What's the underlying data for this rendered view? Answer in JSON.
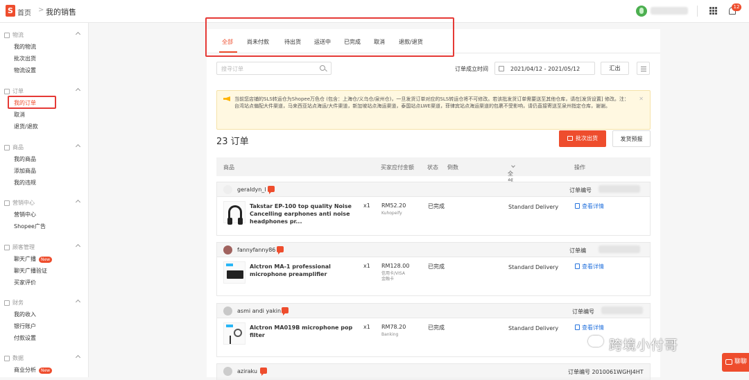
{
  "topbar": {
    "home": "首页",
    "separator": ">",
    "current": "我的销售",
    "notification_count": "12"
  },
  "sidebar": {
    "sections": [
      {
        "title": "物流",
        "items": [
          "我的物流",
          "批次出货",
          "物流设置"
        ]
      },
      {
        "title": "订单",
        "items": [
          "我的订单",
          "取消",
          "退货/退款"
        ]
      },
      {
        "title": "商品",
        "items": [
          "我的商品",
          "添加商品",
          "我的违规"
        ]
      },
      {
        "title": "营销中心",
        "items": [
          "营销中心",
          "Shopee广告"
        ]
      },
      {
        "title": "顾客管理",
        "items": [
          "聊天广播",
          "聊天广播验证",
          "买家评价"
        ]
      },
      {
        "title": "财务",
        "items": [
          "我的收入",
          "银行账户",
          "付款设置"
        ]
      },
      {
        "title": "数据",
        "items": [
          "商业分析"
        ]
      }
    ],
    "badge_new": "New"
  },
  "tabs": [
    "全部",
    "尚未付款",
    "待出货",
    "运送中",
    "已完成",
    "取消",
    "退款/退货"
  ],
  "toolbar": {
    "search_placeholder": "搜寻订单",
    "date_label": "订单成立时间",
    "date_range": "2021/04/12 - 2021/05/12",
    "export": "汇出"
  },
  "notice": "当前您店铺的SLS转运仓为Shopee万色仓 (包含：上海仓/义乌仓/泉州仓)，一旦发货订单对应的SLS转运仓将不可修改。若该批发货订单需要送至其他仓库，请在[发货设置] 修改。注：台湾站点偏配大件渠道，马来西亚站点海运/大件渠道，新加坡站点海运渠道，泰国站点LWE渠道，菲律宾站点海运渠道的包裹不受影响，请仍直接寄送至泉州指定仓库，谢谢。",
  "order_count": "23 订单",
  "buttons": {
    "batch_ship": "批次出货",
    "forecast": "发货预报"
  },
  "table_headers": {
    "product": "商品",
    "paid": "买家应付金额",
    "status": "状态",
    "countdown": "倒数",
    "channel": "全部物流商",
    "action": "操作"
  },
  "orders": [
    {
      "user": "geraldyn_l",
      "order_label": "订单编号",
      "product": "Takstar EP-100 top quality Noise Cancelling earphones anti noise headphones pr...",
      "qty": "x1",
      "price": "RM52.20",
      "payment": "Kuhopeify",
      "status": "已完成",
      "shipping": "Standard Delivery",
      "detail": "查看详情"
    },
    {
      "user": "fannyfanny86",
      "order_label": "订单编",
      "product": "Alctron MA-1 professional microphone preamplifier",
      "qty": "x1",
      "price": "RM128.00",
      "payment": "信用卡/VISA金融卡",
      "status": "已完成",
      "shipping": "Standard Delivery",
      "detail": "查看详情"
    },
    {
      "user": "asmi andi yakin",
      "order_label": "订单编号",
      "product": "Alctron MA019B microphone pop filter",
      "qty": "x1",
      "price": "RM78.20",
      "payment": "Banking",
      "status": "已完成",
      "shipping": "Standard Delivery",
      "detail": "查看详情"
    },
    {
      "user": "aziraku",
      "order_label": "订单编号 2010061WGHJ4HT"
    }
  ],
  "watermark": "跨境小付哥",
  "chat_float": "聊聊"
}
